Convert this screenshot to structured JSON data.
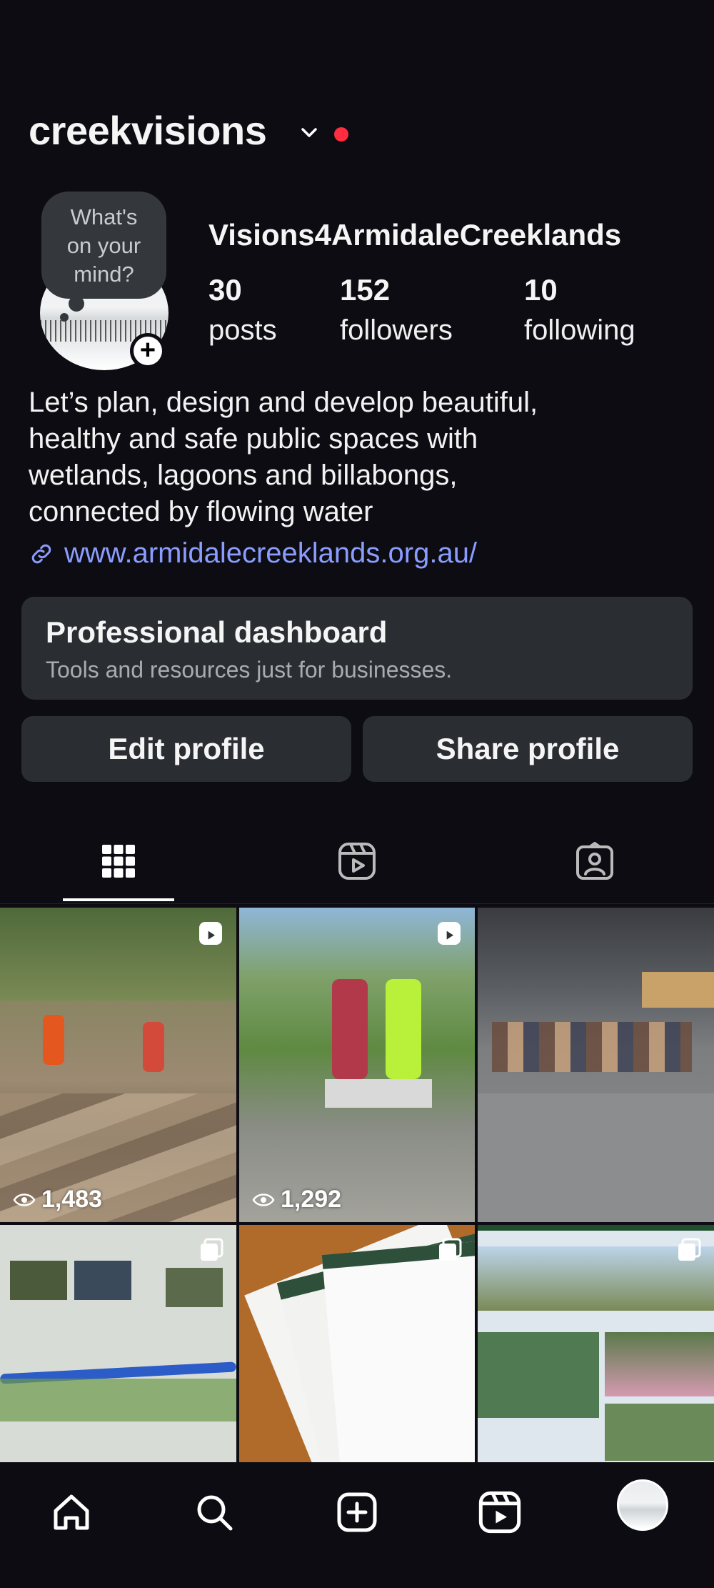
{
  "header": {
    "username": "creekvisions",
    "switch_icon": "chevron-down-icon",
    "notification_dot_color": "#ff2d3f"
  },
  "profile": {
    "note_bubble": "What's\non your\nmind?",
    "full_name": "Visions4ArmidaleCreeklands",
    "stats": [
      {
        "value": "30",
        "label": "posts"
      },
      {
        "value": "152",
        "label": "followers"
      },
      {
        "value": "10",
        "label": "following"
      }
    ],
    "bio": "Let’s plan, design and develop beautiful,\nhealthy and safe public spaces with\nwetlands, lagoons and billabongs,\nconnected by flowing water",
    "link": "www.armidalecreeklands.org.au/",
    "link_color": "#8b9cff"
  },
  "dashboard": {
    "title": "Professional dashboard",
    "subtitle": "Tools and resources just for businesses."
  },
  "buttons": {
    "edit": "Edit profile",
    "share": "Share profile"
  },
  "tabs": [
    "grid-icon",
    "reels-icon",
    "tagged-icon"
  ],
  "posts": [
    {
      "type": "reel",
      "views": "1,483"
    },
    {
      "type": "reel",
      "views": "1,292"
    },
    {
      "type": "photo",
      "views": ""
    },
    {
      "type": "carousel",
      "views": ""
    },
    {
      "type": "carousel",
      "views": ""
    },
    {
      "type": "carousel",
      "views": ""
    }
  ],
  "nav": [
    "home-icon",
    "search-icon",
    "create-icon",
    "reels-icon",
    "profile-avatar"
  ]
}
